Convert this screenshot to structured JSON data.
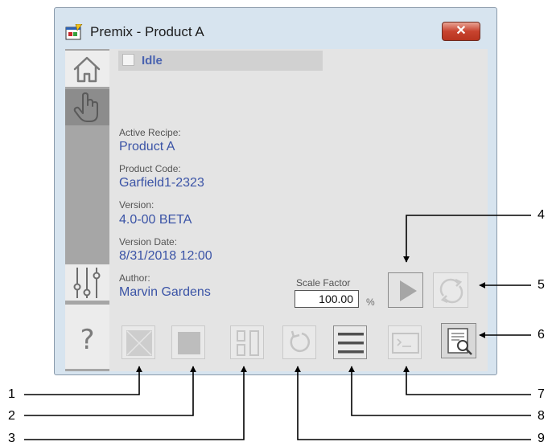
{
  "window": {
    "title": "Premix - Product A",
    "close_symbol": "✕"
  },
  "state": {
    "label": "Idle"
  },
  "recipe": {
    "active_recipe_label": "Active Recipe:",
    "active_recipe": "Product A",
    "product_code_label": "Product Code:",
    "product_code": "Garfield1-2323",
    "version_label": "Version:",
    "version": "4.0-00 BETA",
    "version_date_label": "Version Date:",
    "version_date": "8/31/2018 12:00",
    "author_label": "Author:",
    "author": "Marvin Gardens"
  },
  "scale": {
    "label": "Scale Factor",
    "value": "100.00",
    "unit": "%"
  },
  "sidebar": {
    "help_glyph": "?",
    "icons": [
      "home-icon",
      "hand-icon",
      "sliders-icon",
      "help-icon"
    ]
  },
  "commands": [
    "abort",
    "stop",
    "hold",
    "restart",
    "menu",
    "console",
    "report"
  ],
  "callouts": [
    "1",
    "2",
    "3",
    "4",
    "5",
    "6",
    "7",
    "8",
    "9"
  ],
  "colors": {
    "accent_text": "#3a53a6",
    "play_button": "#a6a6a6",
    "close_button": "#c8432f"
  }
}
